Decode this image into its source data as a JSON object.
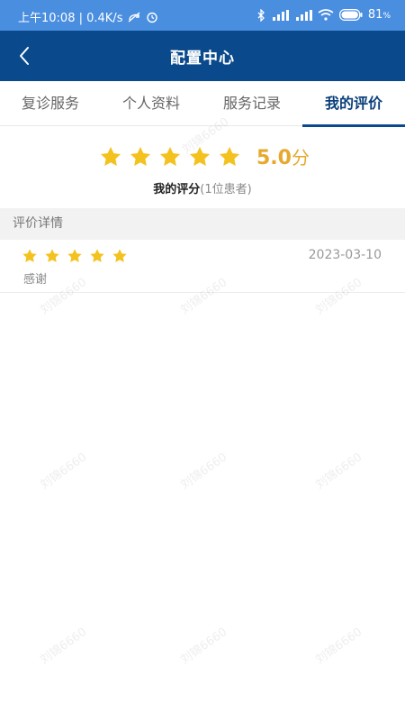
{
  "status_bar": {
    "left_text": "上午10:08 | 0.4K/s",
    "battery": "81"
  },
  "nav": {
    "title": "配置中心",
    "back_icon": "chevron-left-icon"
  },
  "tabs": [
    {
      "label": "复诊服务",
      "active": false
    },
    {
      "label": "个人资料",
      "active": false
    },
    {
      "label": "服务记录",
      "active": false
    },
    {
      "label": "我的评价",
      "active": true
    }
  ],
  "summary": {
    "stars": 5,
    "score": "5.0",
    "unit": "分",
    "label": "我的评分",
    "count_text": "(1位患者)"
  },
  "section_header": "评价详情",
  "reviews": [
    {
      "stars": 5,
      "date": "2023-03-10",
      "comment": "感谢"
    }
  ],
  "watermark_text": "刘锦6660",
  "colors": {
    "status_bar": "#4a8ee0",
    "nav_bar": "#0a4a8c",
    "star": "#f4c21f",
    "score": "#e6a92e"
  }
}
